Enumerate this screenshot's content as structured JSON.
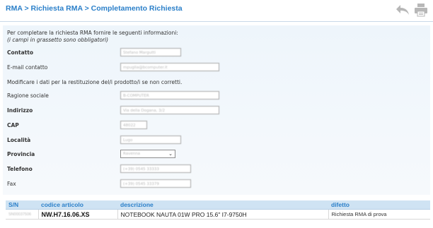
{
  "breadcrumb": {
    "level1": "RMA",
    "sep": ">",
    "level2": "Richiesta RMA",
    "level3": "Completamento Richiesta"
  },
  "header_icons": [
    "back-arrow-icon",
    "printer-icon"
  ],
  "intro": {
    "text": "Per completare la richiesta RMA fornire le seguenti informazioni:",
    "hint": "(i campi in grassetto sono obbligatori)"
  },
  "form": {
    "contatto": {
      "label": "Contatto",
      "value": "Stefano Margutti"
    },
    "email": {
      "label": "E-mail contatto",
      "value": "mpuglia@bcomputer.it"
    },
    "note": "Modificare i dati per la restituzione del/i prodotto/i se non corretti.",
    "ragione_sociale": {
      "label": "Ragione sociale",
      "value": "B-COMPUTER"
    },
    "indirizzo": {
      "label": "Indirizzo",
      "value": "Via della Dogana, 3/2"
    },
    "cap": {
      "label": "CAP",
      "value": "48022"
    },
    "localita": {
      "label": "Località",
      "value": "Lugo"
    },
    "provincia": {
      "label": "Provincia",
      "value": "Ravenna"
    },
    "telefono": {
      "label": "Telefono",
      "value": "(+39) 0545 33333"
    },
    "fax": {
      "label": "Fax",
      "value": "(+39) 0545 33379"
    }
  },
  "table": {
    "headers": [
      "S/N",
      "codice articolo",
      "descrizione",
      "difetto"
    ],
    "rows": [
      {
        "sn": "SN00037506",
        "codice": "NW.H7.16.06.XS",
        "descrizione": "NOTEBOOK NAUTA 01W PRO 15.6\" I7-9750H",
        "difetto": "Richiesta RMA di prova"
      }
    ]
  }
}
